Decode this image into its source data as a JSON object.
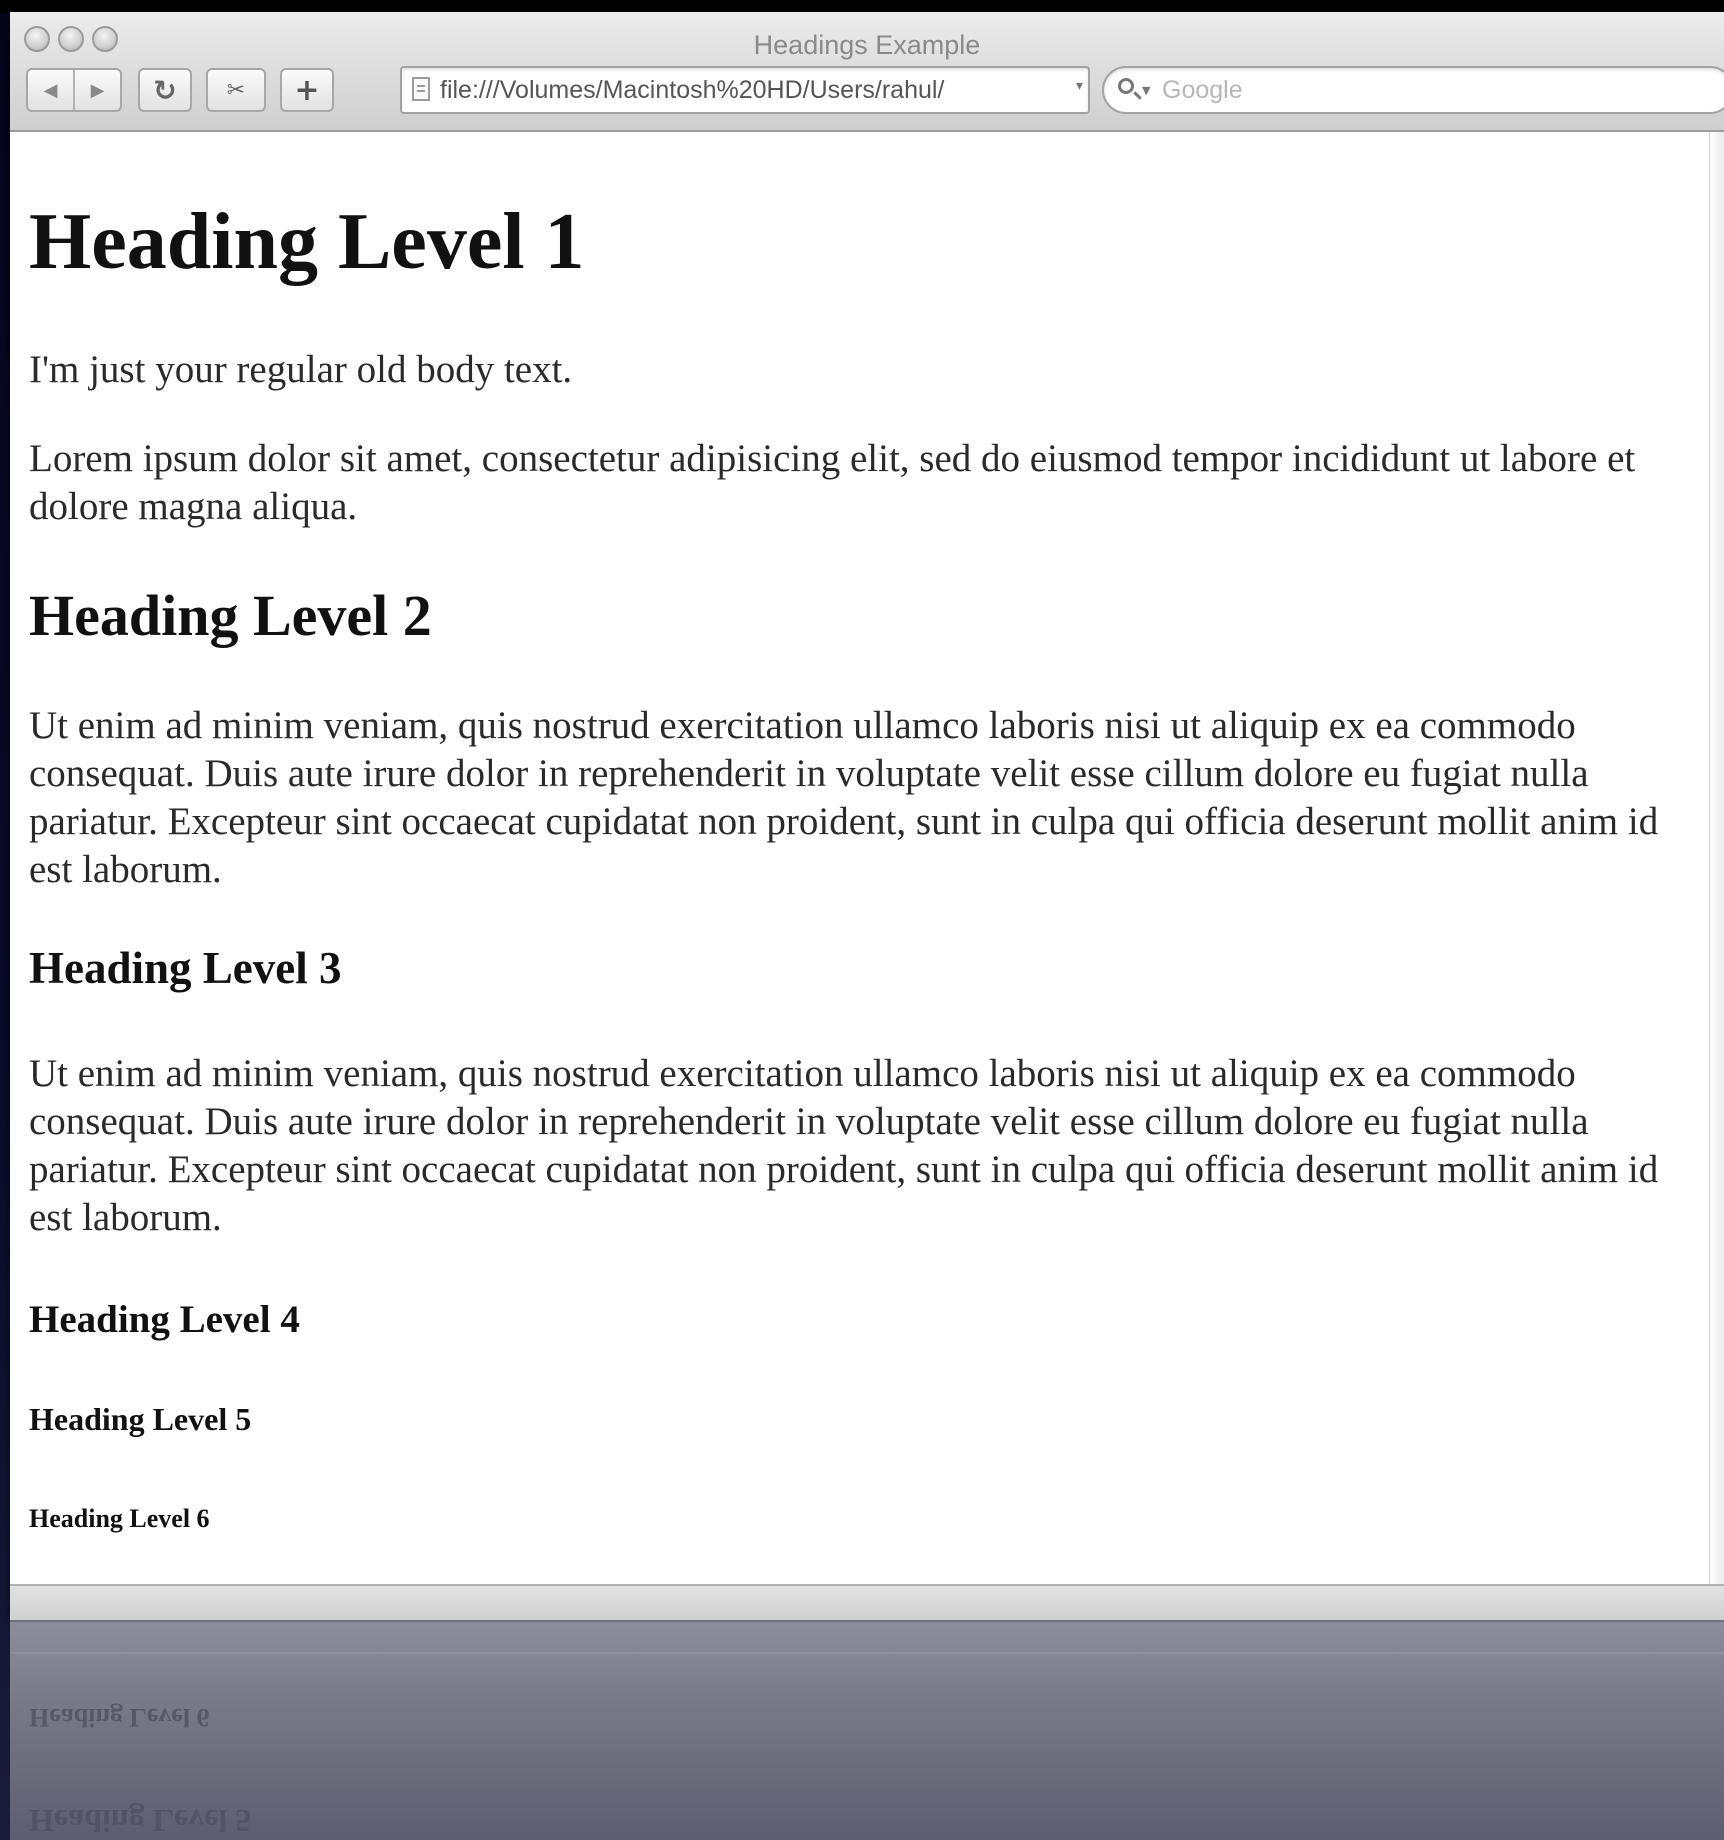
{
  "window": {
    "title": "Headings Example"
  },
  "toolbar": {
    "url": "file:///Volumes/Macintosh%20HD/Users/rahul/",
    "search_placeholder": "Google",
    "icons": [
      "back-icon",
      "forward-icon",
      "reload-icon",
      "snapback-icon",
      "add-bookmark-icon",
      "search-icon"
    ]
  },
  "page": {
    "h1": "Heading Level 1",
    "p1": "I'm just your regular old body text.",
    "p2": "Lorem ipsum dolor sit amet, consectetur adipisicing elit, sed do eiusmod tempor incididunt ut labore et dolore magna aliqua.",
    "h2": "Heading Level 2",
    "p3": "Ut enim ad minim veniam, quis nostrud exercitation ullamco laboris nisi ut aliquip ex ea commodo consequat. Duis aute irure dolor in reprehenderit in voluptate velit esse cillum dolore eu fugiat nulla pariatur. Excepteur sint occaecat cupidatat non proident, sunt in culpa qui officia deserunt mollit anim id est laborum.",
    "h3": "Heading Level 3",
    "p4": "Ut enim ad minim veniam, quis nostrud exercitation ullamco laboris nisi ut aliquip ex ea commodo consequat. Duis aute irure dolor in reprehenderit in voluptate velit esse cillum dolore eu fugiat nulla pariatur. Excepteur sint occaecat cupidatat non proident, sunt in culpa qui officia deserunt mollit anim id est laborum.",
    "h4": "Heading Level 4",
    "h5": "Heading Level 5",
    "h6": "Heading Level 6"
  }
}
